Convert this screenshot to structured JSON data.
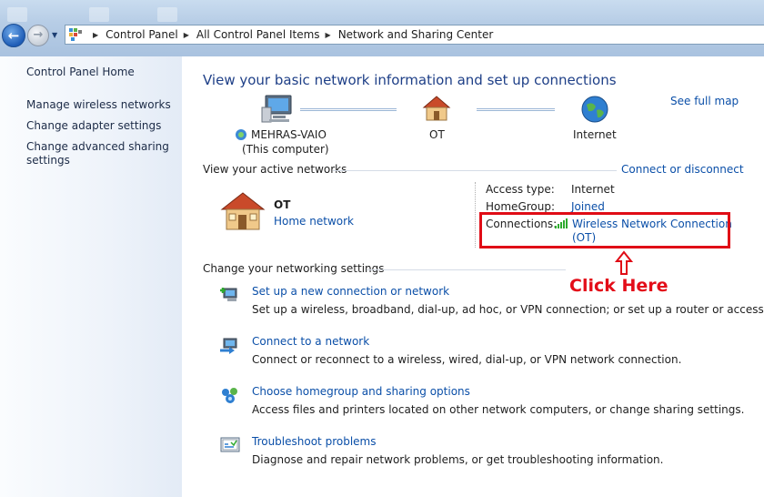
{
  "address_bar": {
    "breadcrumbs": [
      "Control Panel",
      "All Control Panel Items",
      "Network and Sharing Center"
    ]
  },
  "sidebar": {
    "home": "Control Panel Home",
    "items": [
      {
        "label": "Manage wireless networks"
      },
      {
        "label": "Change adapter settings"
      },
      {
        "label": "Change advanced sharing"
      },
      {
        "label": "settings"
      }
    ]
  },
  "main": {
    "title": "View your basic network information and set up connections",
    "see_full_map": "See full map",
    "map": {
      "computer_name": "MEHRAS-VAIO",
      "computer_sub": "(This computer)",
      "network": "OT",
      "internet": "Internet"
    },
    "active_networks": {
      "heading": "View your active networks",
      "connect_disconnect": "Connect or disconnect",
      "network_name": "OT",
      "network_type": "Home network",
      "access_type_label": "Access type:",
      "access_type_value": "Internet",
      "homegroup_label": "HomeGroup:",
      "homegroup_value": "Joined",
      "connections_label": "Connections:",
      "connections_value_1": "Wireless Network Connection",
      "connections_value_2": "(OT)"
    },
    "change_settings": {
      "heading": "Change your networking settings",
      "tasks": [
        {
          "link": "Set up a new connection or network",
          "desc": "Set up a wireless, broadband, dial-up, ad hoc, or VPN connection; or set up a router or access point.",
          "icon": "new-connection-icon"
        },
        {
          "link": "Connect to a network",
          "desc": "Connect or reconnect to a wireless, wired, dial-up, or VPN network connection.",
          "icon": "connect-network-icon"
        },
        {
          "link": "Choose homegroup and sharing options",
          "desc": "Access files and printers located on other network computers, or change sharing settings.",
          "icon": "homegroup-icon"
        },
        {
          "link": "Troubleshoot problems",
          "desc": "Diagnose and repair network problems, or get troubleshooting information.",
          "icon": "troubleshoot-icon"
        }
      ]
    }
  },
  "annotation": {
    "text": "Click Here",
    "color": "#e30d19"
  },
  "colors": {
    "link": "#0b4fa8",
    "title": "#1e3f87",
    "sidebar_bg": "#e3ebf6"
  }
}
